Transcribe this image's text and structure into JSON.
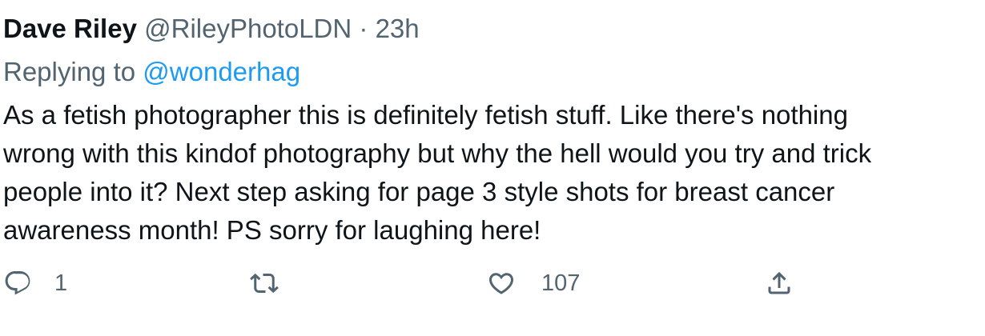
{
  "tweet": {
    "display_name": "Dave Riley",
    "handle": "@RileyPhotoLDN",
    "separator": "·",
    "time": "23h",
    "replying_prefix": "Replying to",
    "replying_to": "@wonderhag",
    "body_lines": [
      "As a fetish photographer this is definitely fetish stuff. Like there's nothing",
      "wrong with this kindof photography but why the hell would you try and trick",
      "people into it? Next step asking for page 3 style shots for breast cancer",
      "awareness month! PS sorry for laughing here!"
    ]
  },
  "actions": {
    "reply": {
      "icon": "reply-icon",
      "count": "1"
    },
    "retweet": {
      "icon": "retweet-icon",
      "count": ""
    },
    "like": {
      "icon": "heart-icon",
      "count": "107"
    },
    "share": {
      "icon": "share-icon",
      "count": ""
    }
  },
  "colors": {
    "text": "#0f1419",
    "secondary": "#536471",
    "link": "#1d9bf0"
  }
}
